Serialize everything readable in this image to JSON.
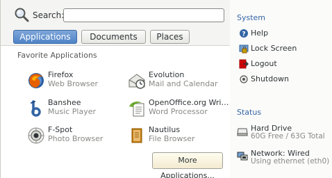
{
  "search": {
    "label": "Search:",
    "value": "",
    "placeholder": ""
  },
  "tabs": [
    {
      "label": "Applications",
      "active": true
    },
    {
      "label": "Documents",
      "active": false
    },
    {
      "label": "Places",
      "active": false
    }
  ],
  "favorites": {
    "title": "Favorite Applications",
    "apps": [
      {
        "name": "Firefox",
        "desc": "Web Browser",
        "icon": "firefox-icon"
      },
      {
        "name": "Evolution",
        "desc": "Mail and Calendar",
        "icon": "evolution-icon"
      },
      {
        "name": "Banshee",
        "desc": "Music Player",
        "icon": "banshee-icon"
      },
      {
        "name": "OpenOffice.org Wri…",
        "desc": "Word Processor",
        "icon": "openoffice-writer-icon"
      },
      {
        "name": "F-Spot",
        "desc": "Photo Browser",
        "icon": "f-spot-icon"
      },
      {
        "name": "Nautilus",
        "desc": "File Browser",
        "icon": "nautilus-icon"
      }
    ],
    "more_label": "More Applications..."
  },
  "system": {
    "title": "System",
    "items": [
      {
        "label": "Help",
        "icon": "help-icon"
      },
      {
        "label": "Lock Screen",
        "icon": "lock-screen-icon"
      },
      {
        "label": "Logout",
        "icon": "logout-icon"
      },
      {
        "label": "Shutdown",
        "icon": "shutdown-icon"
      }
    ]
  },
  "status": {
    "title": "Status",
    "items": [
      {
        "name": "Hard Drive",
        "desc": "60G Free / 63G Total",
        "icon": "hard-drive-icon"
      },
      {
        "name": "Network: Wired",
        "desc": "Using ethernet (eth0)",
        "icon": "network-wired-icon"
      }
    ]
  },
  "colors": {
    "accent": "#3465a4",
    "tab_active": "#4f84c7"
  }
}
